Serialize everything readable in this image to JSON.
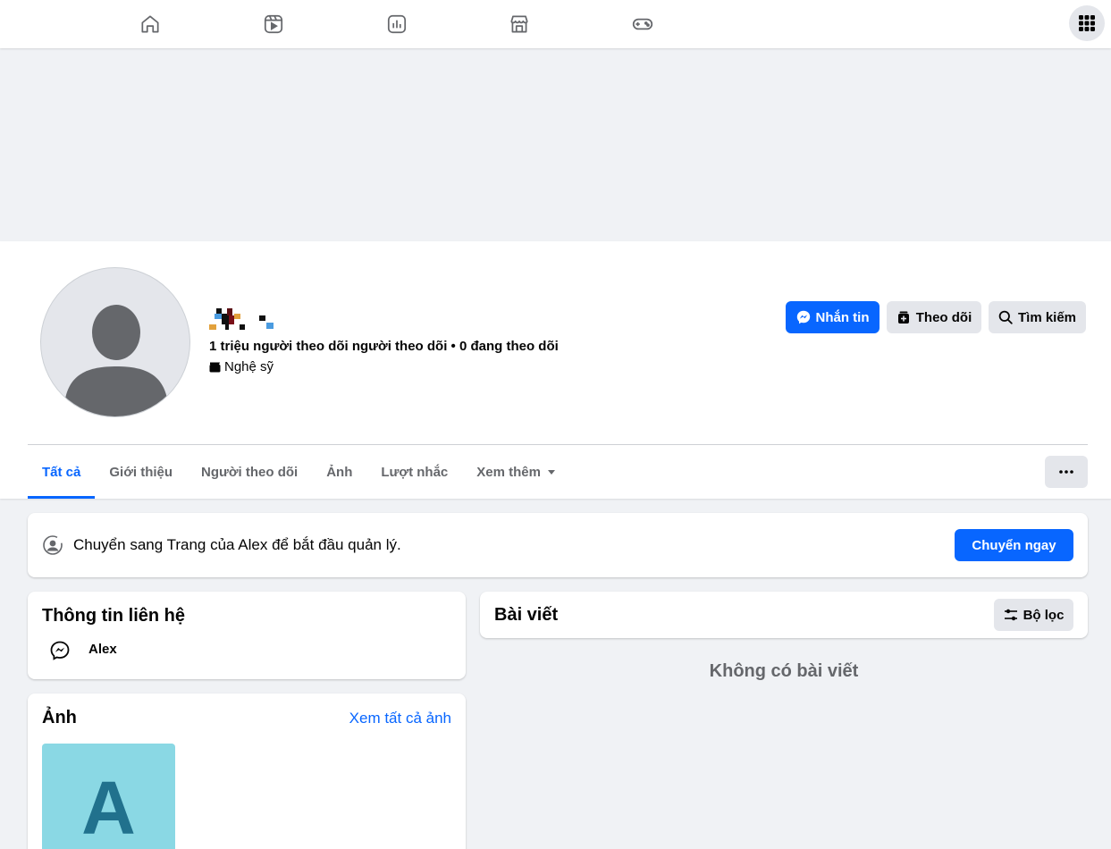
{
  "topnav": {
    "items": [
      "home-icon",
      "watch-icon",
      "feeds-icon",
      "marketplace-icon",
      "gaming-icon"
    ],
    "menu_icon": "grid-menu-icon"
  },
  "profile": {
    "stats": "1 triệu người theo dõi người theo dõi • 0 đang theo dõi",
    "category": "Nghệ sỹ",
    "buttons": {
      "message": "Nhắn tin",
      "follow": "Theo dõi",
      "search": "Tìm kiếm"
    }
  },
  "tabs": [
    {
      "label": "Tất cả",
      "active": true
    },
    {
      "label": "Giới thiệu"
    },
    {
      "label": "Người theo dõi"
    },
    {
      "label": "Ảnh"
    },
    {
      "label": "Lượt nhắc"
    },
    {
      "label": "Xem thêm"
    }
  ],
  "switch_banner": {
    "text": "Chuyển sang Trang của Alex để bắt đầu quản lý.",
    "button": "Chuyển ngay"
  },
  "contact": {
    "title": "Thông tin liên hệ",
    "messenger_name": "Alex"
  },
  "photos": {
    "title": "Ảnh",
    "see_all": "Xem tất cả ảnh",
    "thumb_letter": "A"
  },
  "posts": {
    "title": "Bài viết",
    "filter": "Bộ lọc",
    "empty": "Không có bài viết"
  },
  "colors": {
    "accent": "#0866ff",
    "background": "#f0f2f5",
    "secondary_text": "#65676b"
  }
}
